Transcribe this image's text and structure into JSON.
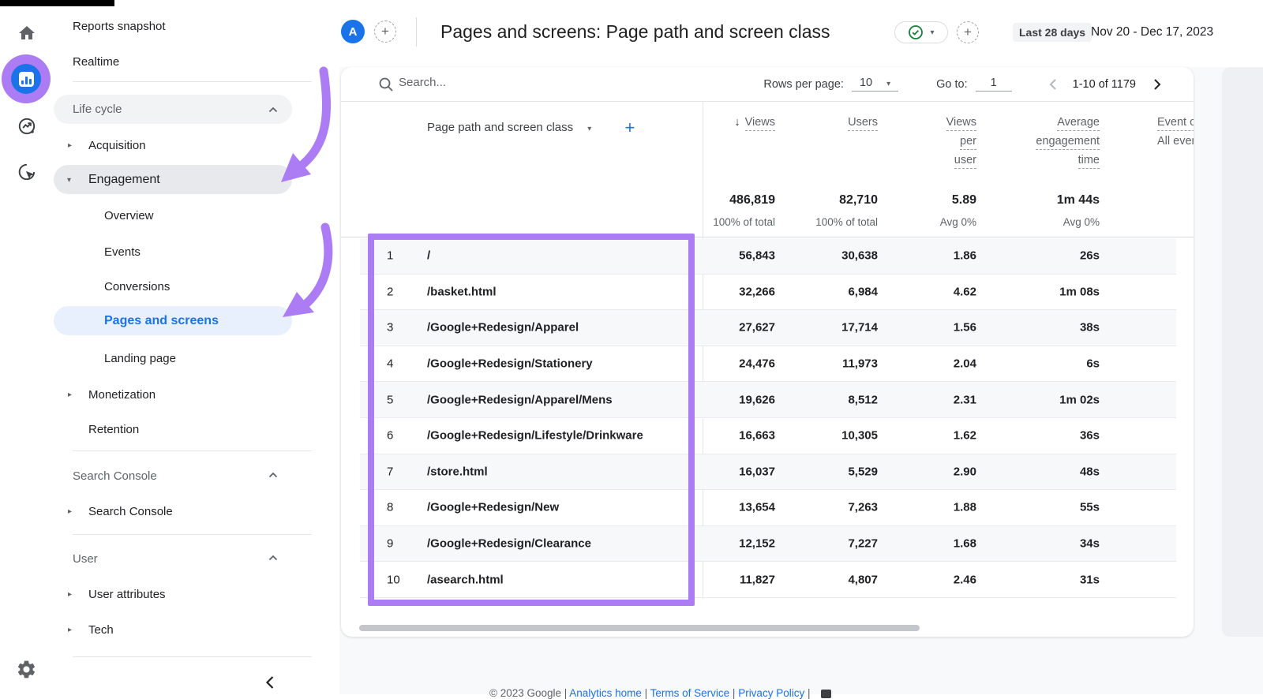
{
  "rail": {
    "icons": [
      "home",
      "reports",
      "explore",
      "advertising",
      "admin-gear"
    ]
  },
  "sidebar": {
    "top_items": [
      {
        "label": "Reports snapshot"
      },
      {
        "label": "Realtime"
      }
    ],
    "sections": [
      {
        "label": "Life cycle",
        "items": [
          {
            "label": "Acquisition",
            "state": "collapsed"
          },
          {
            "label": "Engagement",
            "state": "expanded",
            "children": [
              {
                "label": "Overview"
              },
              {
                "label": "Events"
              },
              {
                "label": "Conversions"
              },
              {
                "label": "Pages and screens",
                "active": true
              },
              {
                "label": "Landing page"
              }
            ]
          },
          {
            "label": "Monetization",
            "state": "collapsed"
          },
          {
            "label": "Retention"
          }
        ]
      },
      {
        "label": "Search Console",
        "items": [
          {
            "label": "Search Console",
            "state": "collapsed"
          }
        ]
      },
      {
        "label": "User",
        "items": [
          {
            "label": "User attributes",
            "state": "collapsed"
          },
          {
            "label": "Tech",
            "state": "collapsed"
          }
        ]
      }
    ]
  },
  "header": {
    "avatar": "A",
    "title": "Pages and screens: Page path and screen class",
    "date_range_preset": "Last 28 days",
    "date_range": "Nov 20 - Dec 17, 2023"
  },
  "toolbar": {
    "search_placeholder": "Search...",
    "rows_per_page_label": "Rows per page:",
    "rows_per_page_value": "10",
    "goto_label": "Go to:",
    "goto_value": "1",
    "range_text": "1-10 of 1179"
  },
  "table": {
    "dimension_header": "Page path and screen class",
    "add_icon": "+",
    "sort_icon": "↓",
    "columns": [
      {
        "lines": [
          "Views"
        ]
      },
      {
        "lines": [
          "Users"
        ]
      },
      {
        "lines": [
          "Views",
          "per",
          "user"
        ]
      },
      {
        "lines": [
          "Average",
          "engagement",
          "time"
        ]
      },
      {
        "lines": [
          "Event count"
        ],
        "sub": "All events",
        "clipped": true
      }
    ],
    "totals": [
      {
        "value": "486,819",
        "sub": "100% of total"
      },
      {
        "value": "82,710",
        "sub": "100% of total"
      },
      {
        "value": "5.89",
        "sub": "Avg 0%"
      },
      {
        "value": "1m 44s",
        "sub": "Avg 0%"
      }
    ],
    "rows": [
      {
        "rank": "1",
        "path": "/",
        "views": "56,843",
        "users": "30,638",
        "views_per_user": "1.86",
        "avg_engagement_time": "26s"
      },
      {
        "rank": "2",
        "path": "/basket.html",
        "views": "32,266",
        "users": "6,984",
        "views_per_user": "4.62",
        "avg_engagement_time": "1m 08s"
      },
      {
        "rank": "3",
        "path": "/Google+Redesign/Apparel",
        "views": "27,627",
        "users": "17,714",
        "views_per_user": "1.56",
        "avg_engagement_time": "38s"
      },
      {
        "rank": "4",
        "path": "/Google+Redesign/Stationery",
        "views": "24,476",
        "users": "11,973",
        "views_per_user": "2.04",
        "avg_engagement_time": "6s"
      },
      {
        "rank": "5",
        "path": "/Google+Redesign/Apparel/Mens",
        "views": "19,626",
        "users": "8,512",
        "views_per_user": "2.31",
        "avg_engagement_time": "1m 02s"
      },
      {
        "rank": "6",
        "path": "/Google+Redesign/Lifestyle/Drinkware",
        "views": "16,663",
        "users": "10,305",
        "views_per_user": "1.62",
        "avg_engagement_time": "36s"
      },
      {
        "rank": "7",
        "path": "/store.html",
        "views": "16,037",
        "users": "5,529",
        "views_per_user": "2.90",
        "avg_engagement_time": "48s"
      },
      {
        "rank": "8",
        "path": "/Google+Redesign/New",
        "views": "13,654",
        "users": "7,263",
        "views_per_user": "1.88",
        "avg_engagement_time": "55s"
      },
      {
        "rank": "9",
        "path": "/Google+Redesign/Clearance",
        "views": "12,152",
        "users": "7,227",
        "views_per_user": "1.68",
        "avg_engagement_time": "34s"
      },
      {
        "rank": "10",
        "path": "/asearch.html",
        "views": "11,827",
        "users": "4,807",
        "views_per_user": "2.46",
        "avg_engagement_time": "31s"
      }
    ]
  },
  "footer": {
    "copyright": "© 2023 Google",
    "links": [
      "Analytics home",
      "Terms of Service",
      "Privacy Policy"
    ]
  },
  "colors": {
    "accent_blue": "#1a73e8",
    "annotation_purple": "#ab7cf3",
    "status_green": "#188038"
  }
}
